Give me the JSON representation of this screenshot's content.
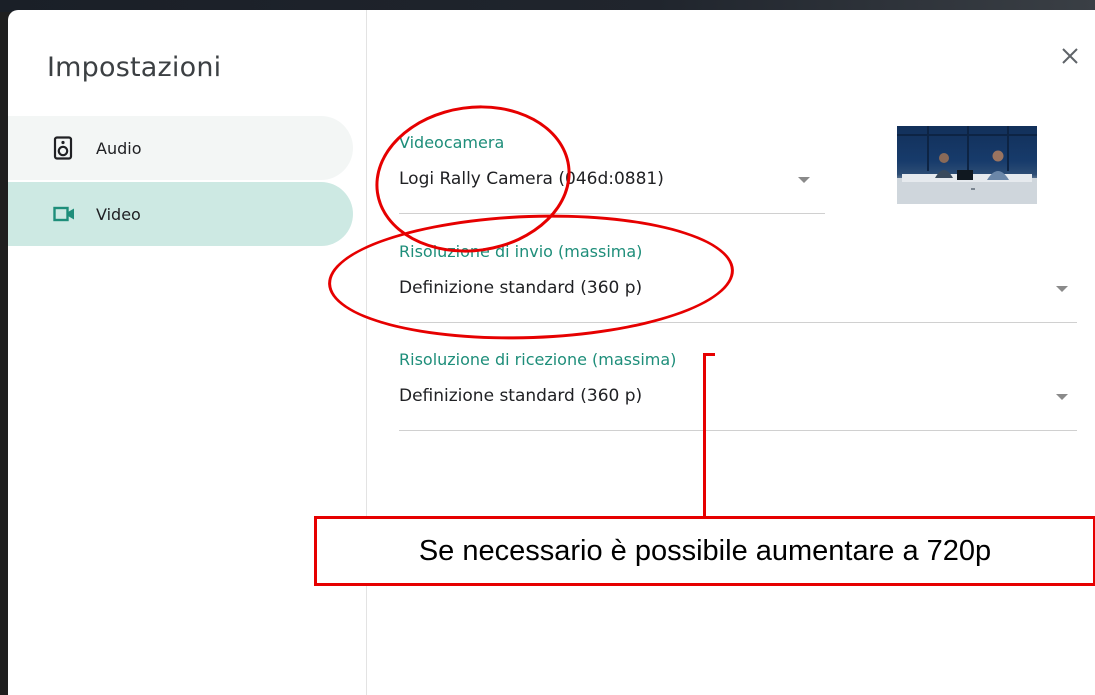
{
  "dialog": {
    "title": "Impostazioni"
  },
  "sidebar": {
    "items": [
      {
        "label": "Audio",
        "icon": "speaker-icon",
        "selected": false
      },
      {
        "label": "Video",
        "icon": "videocam-icon",
        "selected": true
      }
    ]
  },
  "video": {
    "camera": {
      "label": "Videocamera",
      "value": "Logi Rally Camera (046d:0881)"
    },
    "send_resolution": {
      "label": "Risoluzione di invio (massima)",
      "value": "Definizione standard (360 p)"
    },
    "receive_resolution": {
      "label": "Risoluzione di ricezione (massima)",
      "value": "Definizione standard (360 p)"
    }
  },
  "annotation": {
    "callout_text": "Se necessario è possibile aumentare a 720p",
    "color": "#e60000"
  },
  "colors": {
    "accent": "#1e8e7a",
    "selected_nav_bg": "#cde9e3"
  }
}
